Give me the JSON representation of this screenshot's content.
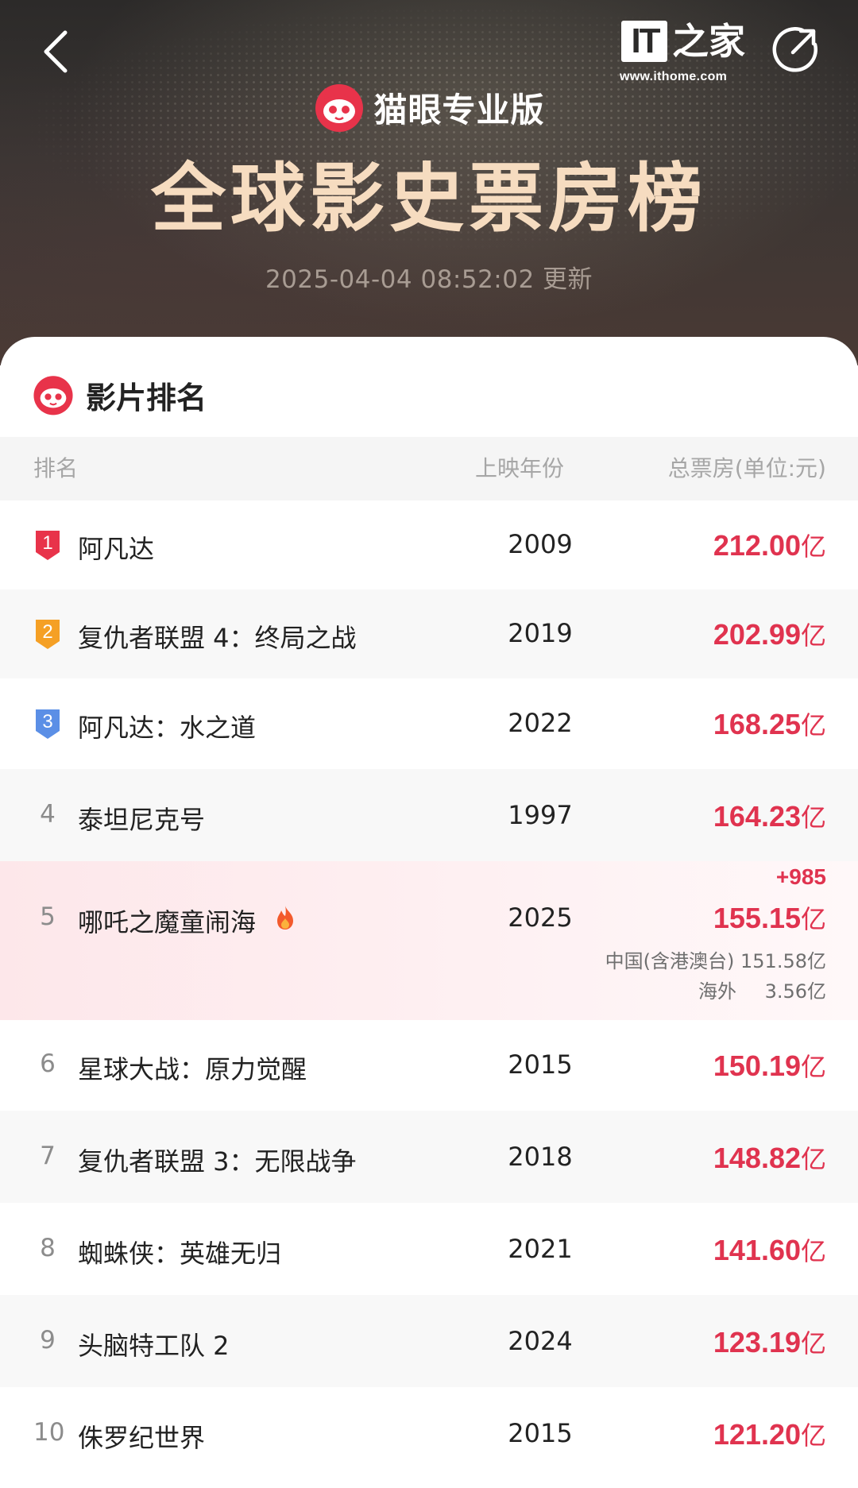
{
  "header": {
    "source_logo": {
      "label": "IT之家",
      "url": "www.ithome.com"
    },
    "brand_name": "猫眼专业版",
    "title": "全球影史票房榜",
    "update_time": "2025-04-04 08:52:02 更新"
  },
  "section": {
    "title": "影片排名"
  },
  "columns": {
    "rank": "排名",
    "year": "上映年份",
    "gross": "总票房(单位:元)"
  },
  "unit": "亿",
  "colors": {
    "accent": "#e0334f",
    "title": "#f6dcc0",
    "rank1": "#e8334a",
    "rank2": "#f5a025",
    "rank3": "#5b8fe6"
  },
  "movies": [
    {
      "rank": "1",
      "title": "阿凡达",
      "year": "2009",
      "gross": "212.00"
    },
    {
      "rank": "2",
      "title": "复仇者联盟 4：终局之战",
      "year": "2019",
      "gross": "202.99"
    },
    {
      "rank": "3",
      "title": "阿凡达：水之道",
      "year": "2022",
      "gross": "168.25"
    },
    {
      "rank": "4",
      "title": "泰坦尼克号",
      "year": "1997",
      "gross": "164.23"
    },
    {
      "rank": "5",
      "title": "哪吒之魔童闹海",
      "year": "2025",
      "gross": "155.15",
      "delta": "+985",
      "breakdown": [
        {
          "label": "中国(含港澳台)",
          "value": "151.58亿"
        },
        {
          "label": "海外",
          "value": "3.56亿"
        }
      ]
    },
    {
      "rank": "6",
      "title": "星球大战：原力觉醒",
      "year": "2015",
      "gross": "150.19"
    },
    {
      "rank": "7",
      "title": "复仇者联盟 3：无限战争",
      "year": "2018",
      "gross": "148.82"
    },
    {
      "rank": "8",
      "title": "蜘蛛侠：英雄无归",
      "year": "2021",
      "gross": "141.60"
    },
    {
      "rank": "9",
      "title": "头脑特工队 2",
      "year": "2024",
      "gross": "123.19"
    },
    {
      "rank": "10",
      "title": "侏罗纪世界",
      "year": "2015",
      "gross": "121.20"
    }
  ]
}
